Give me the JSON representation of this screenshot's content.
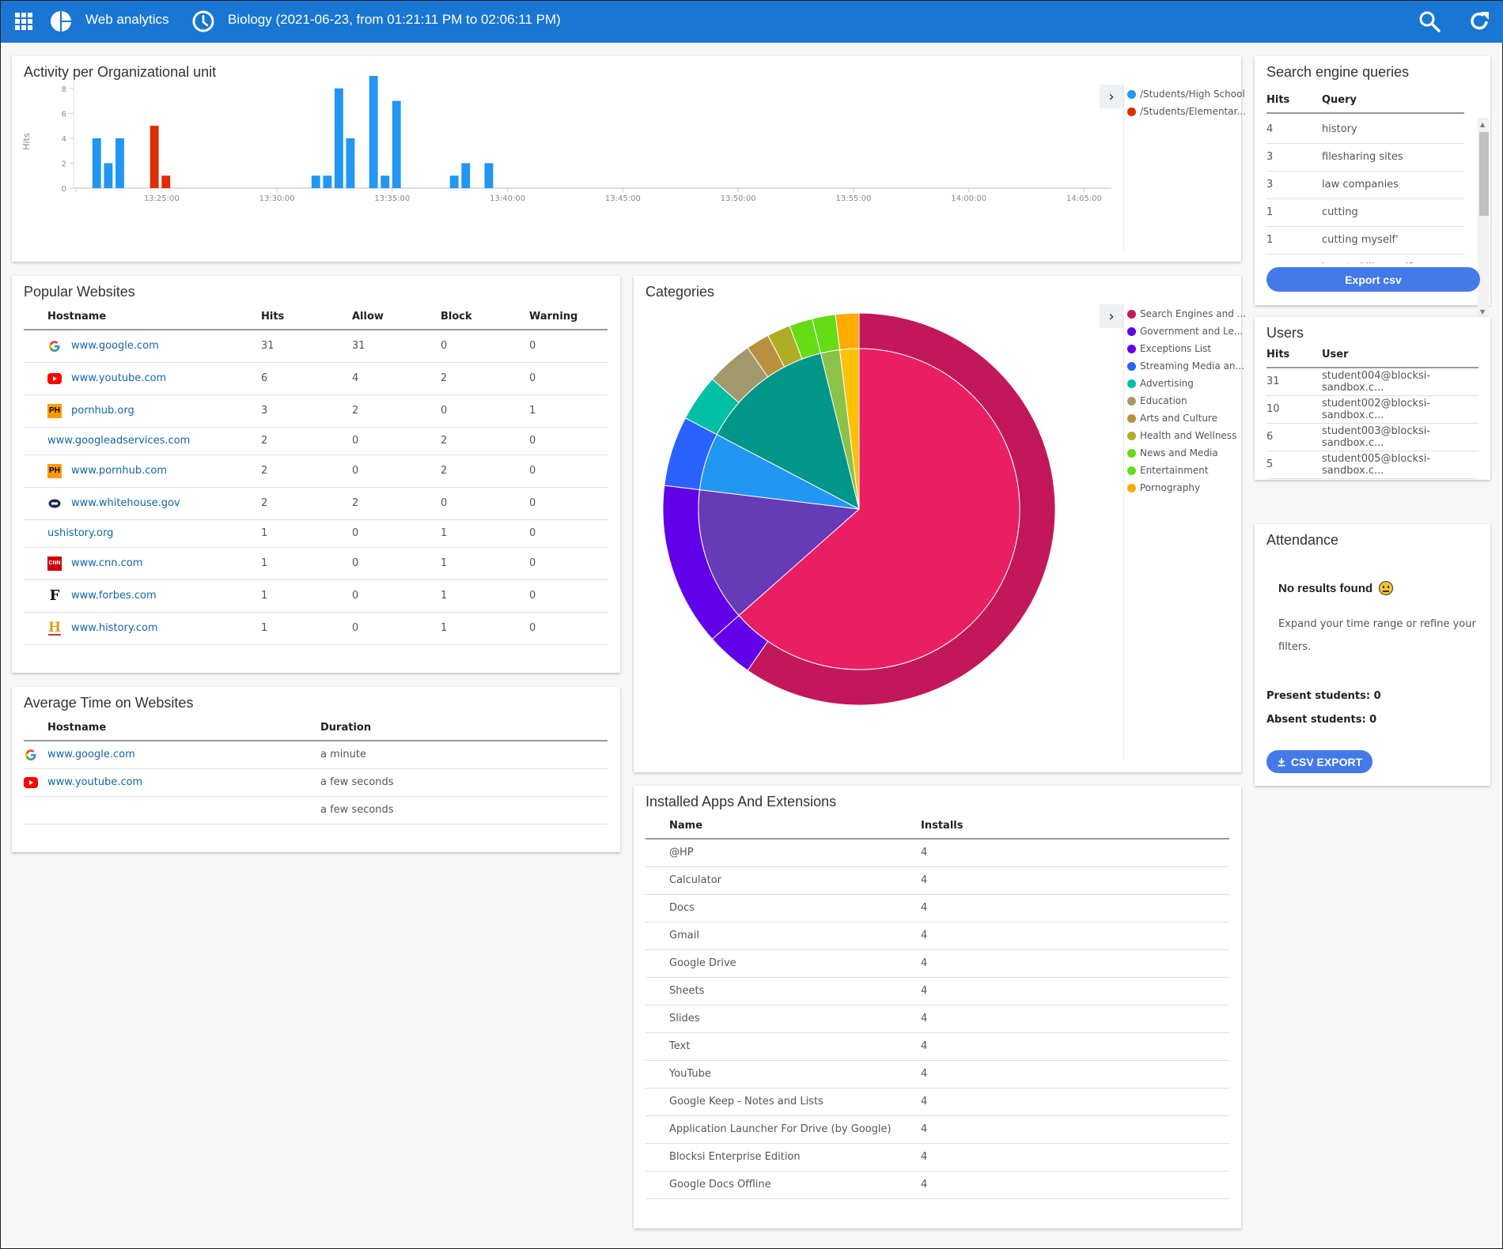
{
  "topbar": {
    "app_title": "Web analytics",
    "range_label": "Biology (2021-06-23, from 01:21:11 PM to 02:06:11 PM)",
    "brand_color": "#1976d2"
  },
  "activity": {
    "title": "Activity per Organizational unit",
    "legend": [
      {
        "label": "/Students/High School",
        "color": "#2196f3"
      },
      {
        "label": "/Students/Elementar...",
        "color": "#dd2c00"
      }
    ]
  },
  "chart_data": [
    {
      "type": "bar",
      "title": "Activity per Organizational unit",
      "xlabel": "",
      "ylabel": "Hits",
      "ylim": [
        0,
        9
      ],
      "yticks": [
        "0",
        "2",
        "4",
        "6",
        "8"
      ],
      "xticks": [
        "13:25:00",
        "13:30:00",
        "13:35:00",
        "13:40:00",
        "13:45:00",
        "13:50:00",
        "13:55:00",
        "14:00:00",
        "14:05:00"
      ],
      "xrange": [
        "13:21:11",
        "14:06:11"
      ],
      "bin_seconds": 30,
      "grid": false,
      "legend_position": "right",
      "series": [
        {
          "name": "/Students/High School",
          "color": "#2196f3",
          "points": [
            {
              "x": "13:22:00",
              "y": 4
            },
            {
              "x": "13:22:30",
              "y": 2
            },
            {
              "x": "13:23:00",
              "y": 4
            },
            {
              "x": "13:31:30",
              "y": 1
            },
            {
              "x": "13:32:00",
              "y": 1
            },
            {
              "x": "13:32:30",
              "y": 8
            },
            {
              "x": "13:33:00",
              "y": 4
            },
            {
              "x": "13:34:00",
              "y": 9
            },
            {
              "x": "13:34:30",
              "y": 1
            },
            {
              "x": "13:35:00",
              "y": 7
            },
            {
              "x": "13:37:30",
              "y": 1
            },
            {
              "x": "13:38:00",
              "y": 2
            },
            {
              "x": "13:39:00",
              "y": 2
            }
          ]
        },
        {
          "name": "/Students/Elementar...",
          "color": "#dd2c00",
          "points": [
            {
              "x": "13:24:30",
              "y": 5
            },
            {
              "x": "13:25:00",
              "y": 1
            }
          ]
        }
      ]
    },
    {
      "type": "pie",
      "title": "Categories",
      "legend_position": "right",
      "outer": [
        {
          "label": "Search Engines and ...",
          "value": 31,
          "color": "#c2185b"
        },
        {
          "label": "Government and Le...",
          "value": 2,
          "color": "#6200ea"
        },
        {
          "label": "Exceptions List",
          "value": 7,
          "color": "#6200ea"
        },
        {
          "label": "Streaming Media an...",
          "value": 3,
          "color": "#2962ff"
        },
        {
          "label": "Advertising",
          "value": 2,
          "color": "#00bfa5"
        },
        {
          "label": "Education",
          "value": 2,
          "color": "#a1996b"
        },
        {
          "label": "Arts and Culture",
          "value": 1,
          "color": "#b8913f"
        },
        {
          "label": "Health and Wellness",
          "value": 1,
          "color": "#afad25"
        },
        {
          "label": "News and Media",
          "value": 1,
          "color": "#64dd17"
        },
        {
          "label": "Entertainment",
          "value": 1,
          "color": "#64dd17"
        },
        {
          "label": "Pornography",
          "value": 1,
          "color": "#ffab00"
        }
      ],
      "inner": [
        {
          "value": 33,
          "color": "#e91e63"
        },
        {
          "value": 7,
          "color": "#673ab7"
        },
        {
          "value": 3,
          "color": "#2196f3"
        },
        {
          "value": 7,
          "color": "#009688"
        },
        {
          "value": 1,
          "color": "#8bc34a"
        },
        {
          "value": 1,
          "color": "#ffc107"
        }
      ]
    }
  ],
  "queries": {
    "title": "Search engine queries",
    "columns": [
      "Hits",
      "Query"
    ],
    "rows": [
      {
        "hits": "4",
        "query": "history"
      },
      {
        "hits": "3",
        "query": "filesharing sites"
      },
      {
        "hits": "3",
        "query": "law companies"
      },
      {
        "hits": "1",
        "query": "cutting"
      },
      {
        "hits": "1",
        "query": "cutting myself'"
      },
      {
        "hits": "",
        "query": "how to kill myself"
      }
    ],
    "export_label": "Export csv"
  },
  "popular": {
    "title": "Popular Websites",
    "columns": [
      "Hostname",
      "Hits",
      "Allow",
      "Block",
      "Warning"
    ],
    "rows": [
      {
        "icon": "google",
        "host": "www.google.com",
        "hits": "31",
        "allow": "31",
        "block": "0",
        "warning": "0"
      },
      {
        "icon": "youtube",
        "host": "www.youtube.com",
        "hits": "6",
        "allow": "4",
        "block": "2",
        "warning": "0"
      },
      {
        "icon": "ph",
        "host": "pornhub.org",
        "hits": "3",
        "allow": "2",
        "block": "0",
        "warning": "1"
      },
      {
        "icon": "",
        "host": "www.googleadservices.com",
        "hits": "2",
        "allow": "0",
        "block": "2",
        "warning": "0"
      },
      {
        "icon": "ph",
        "host": "www.pornhub.com",
        "hits": "2",
        "allow": "0",
        "block": "2",
        "warning": "0"
      },
      {
        "icon": "whitehouse",
        "host": "www.whitehouse.gov",
        "hits": "2",
        "allow": "2",
        "block": "0",
        "warning": "0"
      },
      {
        "icon": "",
        "host": "ushistory.org",
        "hits": "1",
        "allow": "0",
        "block": "1",
        "warning": "0"
      },
      {
        "icon": "cnn",
        "host": "www.cnn.com",
        "hits": "1",
        "allow": "0",
        "block": "1",
        "warning": "0"
      },
      {
        "icon": "forbes",
        "host": "www.forbes.com",
        "hits": "1",
        "allow": "0",
        "block": "1",
        "warning": "0"
      },
      {
        "icon": "history",
        "host": "www.history.com",
        "hits": "1",
        "allow": "0",
        "block": "1",
        "warning": "0"
      }
    ]
  },
  "avgtime": {
    "title": "Average Time on Websites",
    "columns": [
      "Hostname",
      "Duration"
    ],
    "rows": [
      {
        "icon": "google",
        "host": "www.google.com",
        "duration": "a minute"
      },
      {
        "icon": "youtube",
        "host": "www.youtube.com",
        "duration": "a few seconds"
      },
      {
        "icon": "",
        "host": "",
        "duration": "a few seconds"
      }
    ]
  },
  "categories": {
    "title": "Categories"
  },
  "users": {
    "title": "Users",
    "columns": [
      "Hits",
      "User"
    ],
    "rows": [
      {
        "hits": "31",
        "user": "student004@blocksi-sandbox.c..."
      },
      {
        "hits": "10",
        "user": "student002@blocksi-sandbox.c..."
      },
      {
        "hits": "6",
        "user": "student003@blocksi-sandbox.c..."
      },
      {
        "hits": "5",
        "user": "student005@blocksi-sandbox.c..."
      }
    ]
  },
  "attendance": {
    "title": "Attendance",
    "no_results": "No results found",
    "hint": "Expand your time range or refine your filters.",
    "present": "Present students: 0",
    "absent": "Absent students: 0",
    "csv_label": "CSV EXPORT"
  },
  "apps": {
    "title": "Installed Apps And Extensions",
    "columns": [
      "Name",
      "Installs"
    ],
    "rows": [
      {
        "name": "@HP",
        "installs": "4"
      },
      {
        "name": "Calculator",
        "installs": "4"
      },
      {
        "name": "Docs",
        "installs": "4"
      },
      {
        "name": "Gmail",
        "installs": "4"
      },
      {
        "name": "Google Drive",
        "installs": "4"
      },
      {
        "name": "Sheets",
        "installs": "4"
      },
      {
        "name": "Slides",
        "installs": "4"
      },
      {
        "name": "Text",
        "installs": "4"
      },
      {
        "name": "YouTube",
        "installs": "4"
      },
      {
        "name": "Google Keep - Notes and Lists",
        "installs": "4"
      },
      {
        "name": "Application Launcher For Drive (by Google)",
        "installs": "4"
      },
      {
        "name": "Blocksi Enterprise Edition",
        "installs": "4"
      },
      {
        "name": "Google Docs Offline",
        "installs": "4"
      }
    ]
  }
}
